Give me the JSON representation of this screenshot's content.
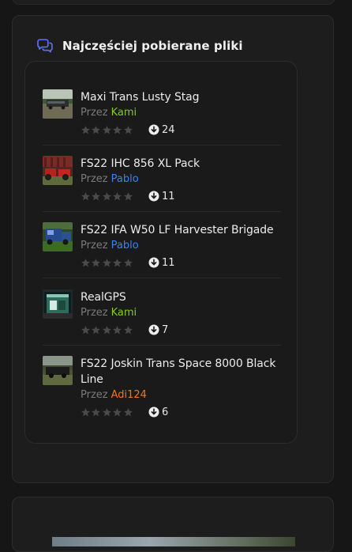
{
  "widget": {
    "title": "Najczęściej pobierane pliki",
    "icon": "chat-bubbles-icon",
    "accent_color": "#5b6ee8"
  },
  "files": [
    {
      "title": "Maxi Trans Lusty Stag",
      "by_label": "Przez",
      "author": "Kami",
      "author_color": "#84cc16",
      "rating_stars": 0,
      "downloads": "24",
      "thumb": "trailer-field-thumbnail"
    },
    {
      "title": "FS22 IHC 856 XL Pack",
      "by_label": "Przez",
      "author": "Pablo",
      "author_color": "#3b82f6",
      "rating_stars": 0,
      "downloads": "11",
      "thumb": "red-tractors-thumbnail"
    },
    {
      "title": "FS22 IFA W50 LF Harvester Brigade",
      "by_label": "Przez",
      "author": "Pablo",
      "author_color": "#3b82f6",
      "rating_stars": 0,
      "downloads": "11",
      "thumb": "blue-truck-thumbnail"
    },
    {
      "title": "RealGPS",
      "by_label": "Przez",
      "author": "Kami",
      "author_color": "#84cc16",
      "rating_stars": 0,
      "downloads": "7",
      "thumb": "gps-screen-thumbnail"
    },
    {
      "title": "FS22 Joskin Trans Space 8000 Black Line",
      "by_label": "Przez",
      "author": "Adi124",
      "author_color": "#f97316",
      "rating_stars": 0,
      "downloads": "6",
      "thumb": "black-trailer-thumbnail"
    }
  ],
  "icons": {
    "star": "star-icon",
    "download": "download-arrow-icon"
  },
  "colors": {
    "star_empty": "#4a4a4a",
    "card_bg": "#1d1d1d",
    "inner_bg": "#1a1a1a"
  }
}
